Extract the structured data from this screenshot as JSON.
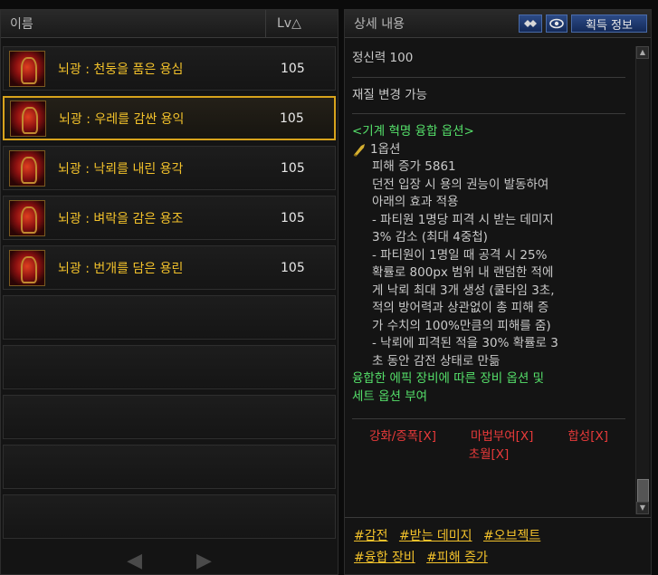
{
  "left": {
    "col_name": "이름",
    "col_lv": "Lv△",
    "items": [
      {
        "name": "뇌광 : 천둥을 품은 용심",
        "lv": "105"
      },
      {
        "name": "뇌광 : 우레를 감싼 용익",
        "lv": "105"
      },
      {
        "name": "뇌광 : 낙뢰를 내린 용각",
        "lv": "105"
      },
      {
        "name": "뇌광 : 벼락을 감은 용조",
        "lv": "105"
      },
      {
        "name": "뇌광 : 번개를 담은 용린",
        "lv": "105"
      }
    ],
    "selected_index": 1,
    "prev_arrow": "◀",
    "next_arrow": "▶"
  },
  "right": {
    "title": "상세 내용",
    "get_info_button": "획득 정보",
    "stat": "정신력 100",
    "material": "재질 변경 가능",
    "fusion_header": "<기계 혁명 융합 옵션>",
    "option_title": "1옵션",
    "lines": [
      "피해 증가 5861",
      "던전 입장 시 용의 권능이 발동하여",
      "아래의 효과 적용",
      "- 파티원 1명당 피격 시 받는 데미지",
      "3% 감소 (최대 4중첩)",
      "- 파티원이 1명일 때 공격 시 25%",
      "확률로 800px 범위 내 랜덤한 적에",
      "게 낙뢰 최대 3개 생성 (쿨타임 3초,",
      "적의 방어력과 상관없이 총 피해 증",
      "가 수치의 100%만큼의 피해를 줌)",
      "- 낙뢰에 피격된 적을 30% 확률로 3",
      "초 동안 감전 상태로 만듦"
    ],
    "fusion_note_1": "융합한 에픽 장비에 따른 장비 옵션 및",
    "fusion_note_2": "세트 옵션 부여",
    "restrictions": {
      "enhance": "강화/증폭[X]",
      "enchant": "마법부여[X]",
      "synth": "합성[X]",
      "transcend": "초월[X]"
    },
    "tags": [
      "#감전",
      "#받는 데미지",
      "#오브젝트",
      "#융합 장비",
      "#피해 증가"
    ]
  }
}
